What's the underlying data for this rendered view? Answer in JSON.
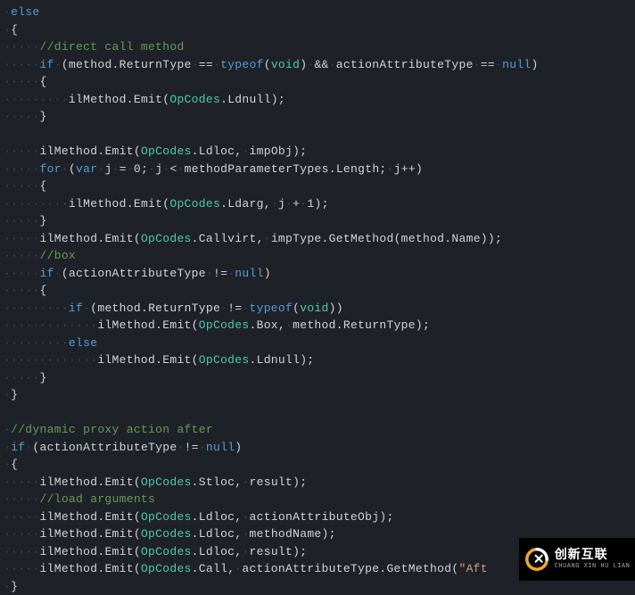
{
  "code": {
    "t": {
      "else": "else",
      "if": "if",
      "for": "for",
      "var": "var",
      "typeof": "typeof",
      "void": "void",
      "null": "null",
      "OpCodes": "OpCodes",
      "and": "&&",
      "eqeq": "==",
      "neq": "!=",
      "pp": "++",
      "lt": "<",
      "eq": "=",
      "zero": "0",
      "one": "1",
      "j": "j"
    },
    "id": {
      "method": "method",
      "ReturnType": "ReturnType",
      "actionAttributeType": "actionAttributeType",
      "ilMethod": "ilMethod",
      "Emit": "Emit",
      "Ldnull": "Ldnull",
      "Ldloc": "Ldloc",
      "Ldarg": "Ldarg",
      "Stloc": "Stloc",
      "Call": "Call",
      "Callvirt": "Callvirt",
      "Box": "Box",
      "impObj": "impObj",
      "impType": "impType",
      "GetMethod": "GetMethod",
      "Name": "Name",
      "methodParameterTypes": "methodParameterTypes",
      "Length": "Length",
      "result": "result",
      "actionAttributeObj": "actionAttributeObj",
      "methodName": "methodName"
    },
    "cm": {
      "direct": "//direct call method",
      "box": "//box",
      "dyn": "//dynamic proxy action after",
      "load": "//load arguments"
    },
    "str": {
      "aft": "\"Aft"
    }
  },
  "logo": {
    "cn": "创新互联",
    "py": "CHUANG XIN HU LIAN"
  }
}
